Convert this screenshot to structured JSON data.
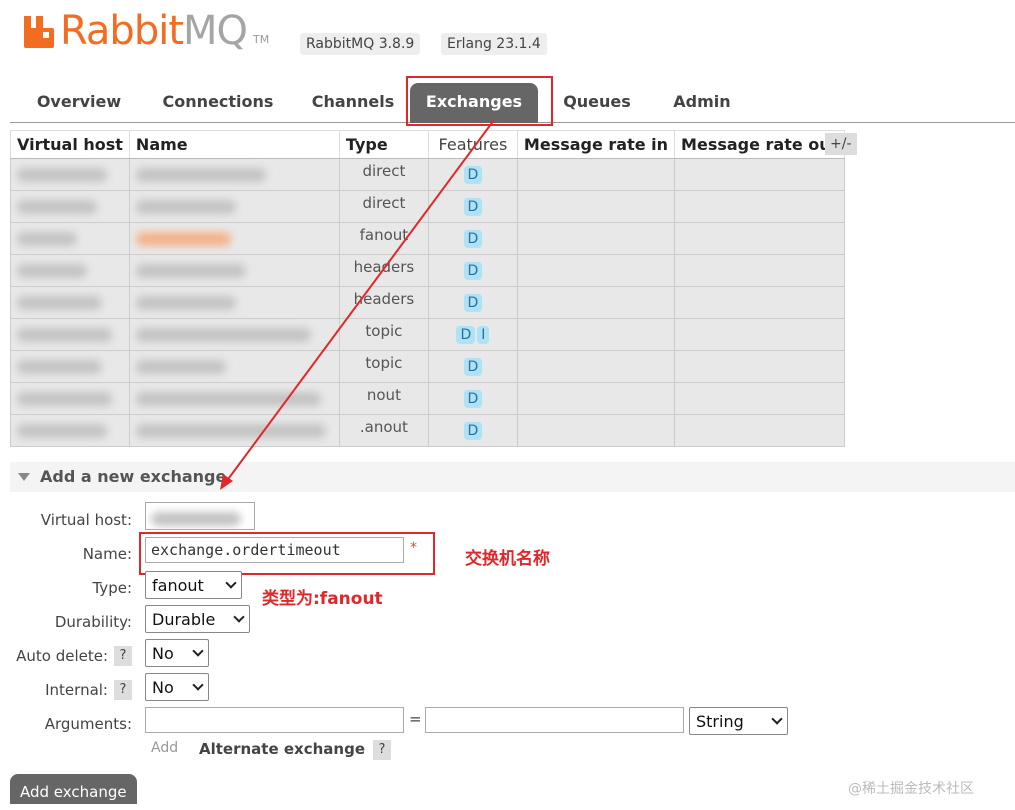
{
  "app": {
    "logo_text_main": "Rabbit",
    "logo_text_accent": "MQ",
    "logo_tm": "TM",
    "version_rabbit": "RabbitMQ 3.8.9",
    "version_erlang": "Erlang 23.1.4"
  },
  "nav": {
    "tabs": [
      "Overview",
      "Connections",
      "Channels",
      "Exchanges",
      "Queues",
      "Admin"
    ],
    "active": "Exchanges"
  },
  "table": {
    "headers": [
      "Virtual host",
      "Name",
      "Type",
      "Features",
      "Message rate in",
      "Message rate out"
    ],
    "plus_minus": "+/-",
    "rows": [
      {
        "type": "direct",
        "features": [
          "D"
        ]
      },
      {
        "type": "direct",
        "features": [
          "D"
        ]
      },
      {
        "type": "fanout",
        "features": [
          "D"
        ]
      },
      {
        "type": "headers",
        "features": [
          "D"
        ]
      },
      {
        "type": "headers",
        "features": [
          "D"
        ]
      },
      {
        "type": "topic",
        "features": [
          "D",
          "I"
        ]
      },
      {
        "type": "topic",
        "features": [
          "D"
        ]
      },
      {
        "type": "nout",
        "features": [
          "D"
        ]
      },
      {
        "type": ".anout",
        "features": [
          "D"
        ]
      }
    ]
  },
  "form": {
    "section_title": "Add a new exchange",
    "virtual_host_label": "Virtual host:",
    "name_label": "Name:",
    "name_value": "exchange.ordertimeout",
    "required_mark": "*",
    "type_label": "Type:",
    "type_value": "fanout",
    "durability_label": "Durability:",
    "durability_value": "Durable",
    "auto_delete_label": "Auto delete:",
    "auto_delete_value": "No",
    "internal_label": "Internal:",
    "internal_value": "No",
    "help_mark": "?",
    "arguments_label": "Arguments:",
    "equals": "=",
    "arg_type_value": "String",
    "add_link": "Add",
    "alternate_exchange": "Alternate exchange",
    "submit_label": "Add exchange"
  },
  "annotations": {
    "name_note": "交换机名称",
    "type_note": "类型为:fanout",
    "color": "#e0282b"
  },
  "watermark": "@稀土掘金技术社区",
  "colors": {
    "brand_orange": "#f26d21",
    "active_tab": "#666666",
    "feature_badge": "#aee3f5"
  }
}
